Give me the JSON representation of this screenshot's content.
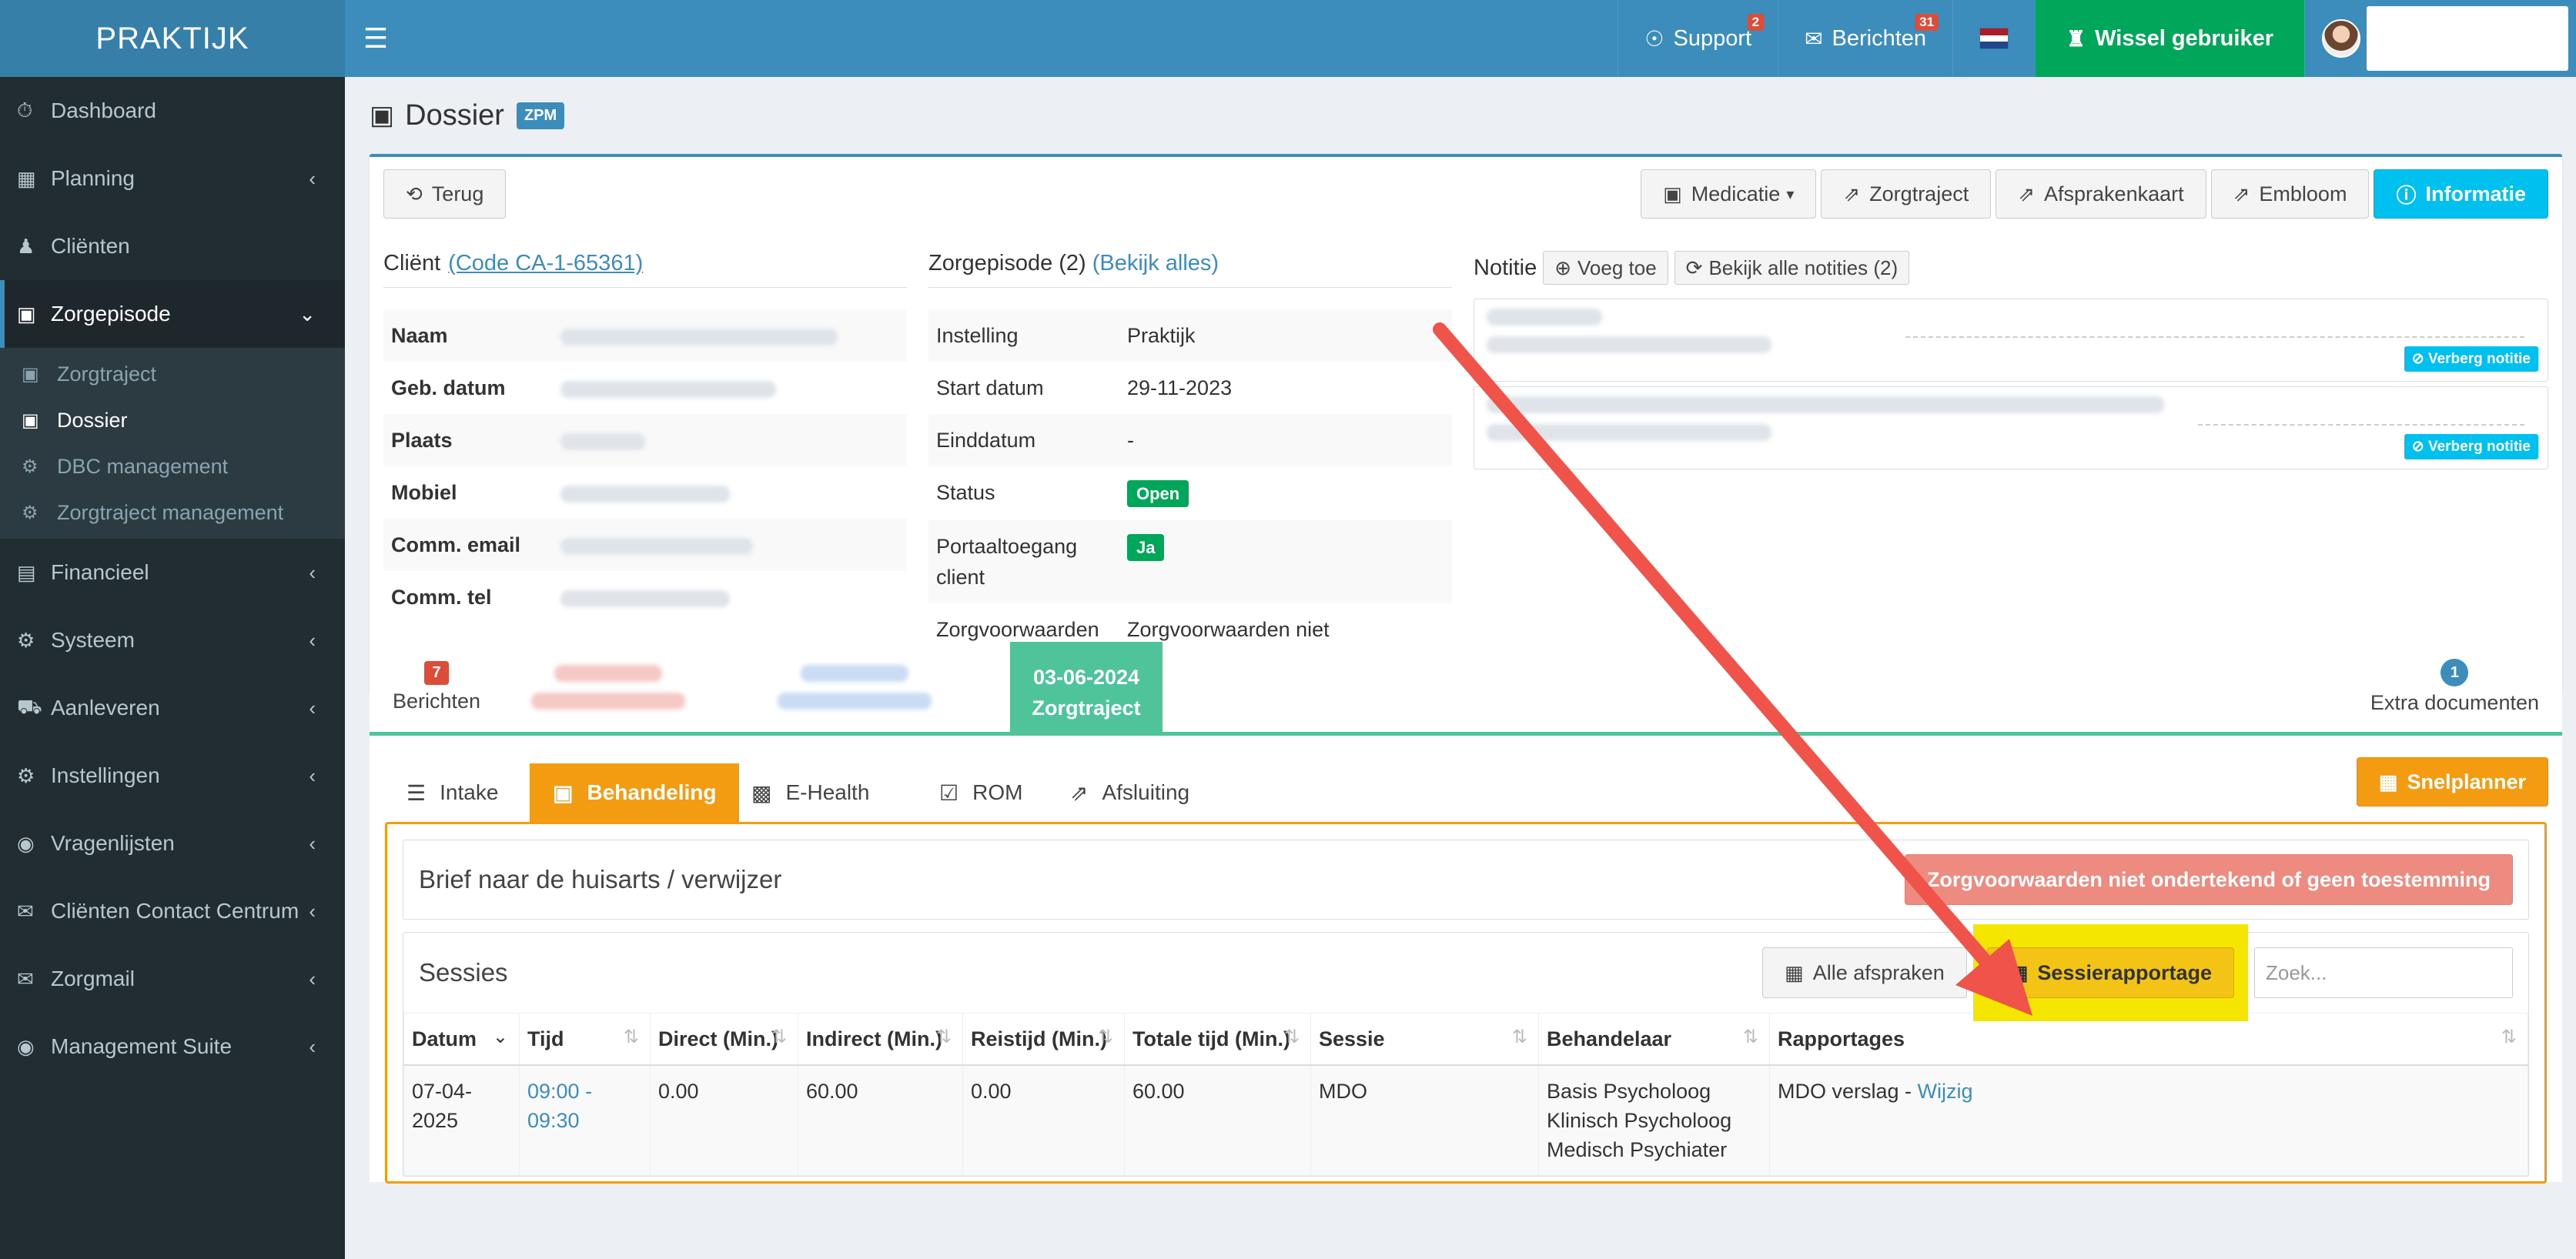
{
  "header": {
    "logo": "PRAKTIJK",
    "support_label": "Support",
    "support_badge": "2",
    "berichten_label": "Berichten",
    "berichten_badge": "31",
    "wissel_label": "Wissel gebruiker",
    "accent_color": "#3c8dbc",
    "success_color": "#00a65a"
  },
  "sidebar": {
    "items": [
      {
        "label": "Dashboard",
        "icon": "dashboard-icon"
      },
      {
        "label": "Planning",
        "icon": "calendar-icon"
      },
      {
        "label": "Cliënten",
        "icon": "user-icon"
      },
      {
        "label": "Zorgepisode",
        "icon": "medkit-icon"
      },
      {
        "label": "Financieel",
        "icon": "book-icon"
      },
      {
        "label": "Systeem",
        "icon": "cogs-icon"
      },
      {
        "label": "Aanleveren",
        "icon": "truck-icon"
      },
      {
        "label": "Instellingen",
        "icon": "gear-icon"
      },
      {
        "label": "Vragenlijsten",
        "icon": "globe-icon"
      },
      {
        "label": "Cliënten Contact Centrum",
        "icon": "envelope-icon"
      },
      {
        "label": "Zorgmail",
        "icon": "envelope-icon"
      },
      {
        "label": "Management Suite",
        "icon": "globe-icon"
      }
    ],
    "subitems": [
      {
        "label": "Zorgtraject"
      },
      {
        "label": "Dossier"
      },
      {
        "label": "DBC management"
      },
      {
        "label": "Zorgtraject management"
      }
    ]
  },
  "page": {
    "title": "Dossier",
    "badge": "ZPM"
  },
  "toolbar": {
    "back": "Terug",
    "medicatie": "Medicatie",
    "zorgtraject": "Zorgtraject",
    "afsprakenkaart": "Afsprakenkaart",
    "embloom": "Embloom",
    "informatie": "Informatie"
  },
  "client": {
    "heading": "Cliënt",
    "code_link": "(Code CA-1-65361)",
    "rows": [
      {
        "label": "Naam"
      },
      {
        "label": "Geb. datum"
      },
      {
        "label": "Plaats"
      },
      {
        "label": "Mobiel"
      },
      {
        "label": "Comm. email"
      },
      {
        "label": "Comm. tel"
      }
    ]
  },
  "zorgepisode": {
    "heading": "Zorgepisode (2)",
    "link": "(Bekijk alles)",
    "rows": [
      {
        "label": "Instelling",
        "value": "Praktijk"
      },
      {
        "label": "Start datum",
        "value": "29-11-2023"
      },
      {
        "label": "Einddatum",
        "value": "-"
      },
      {
        "label": "Status",
        "value": "Open"
      },
      {
        "label": "Portaaltoegang client",
        "value": "Ja"
      },
      {
        "label": "Zorgvoorwaarden",
        "value": "Zorgvoorwaarden niet ondertekend of geen toestemming"
      }
    ]
  },
  "notitie": {
    "heading": "Notitie",
    "add": "Voeg toe",
    "view_all": "Bekijk alle notities (2)",
    "hide_label": "Verberg notitie"
  },
  "timeline": {
    "berichten_badge": "7",
    "berichten": "Berichten",
    "active_date": "03-06-2024",
    "active_label": "Zorgtraject",
    "extra_badge": "1",
    "extra": "Extra documenten"
  },
  "tabs": [
    {
      "label": "Intake"
    },
    {
      "label": "Behandeling"
    },
    {
      "label": "E-Health"
    },
    {
      "label": "ROM"
    },
    {
      "label": "Afsluiting"
    }
  ],
  "snelplanner": "Snelplanner",
  "brief": {
    "title": "Brief naar de huisarts / verwijzer",
    "warning": "Zorgvoorwaarden niet ondertekend of geen toestemming"
  },
  "sessies": {
    "title": "Sessies",
    "alle_afspraken": "Alle afspraken",
    "sessierapportage": "Sessierapportage",
    "search_placeholder": "Zoek...",
    "columns": [
      "Datum",
      "Tijd",
      "Direct (Min.)",
      "Indirect (Min.)",
      "Reistijd (Min.)",
      "Totale tijd (Min.)",
      "Sessie",
      "Behandelaar",
      "Rapportages"
    ],
    "rows": [
      {
        "datum": "07-04-2025",
        "tijd": "09:00 - 09:30",
        "direct": "0.00",
        "indirect": "60.00",
        "reistijd": "0.00",
        "totaal": "60.00",
        "sessie": "MDO",
        "behandelaar_1": "Basis Psycholoog",
        "behandelaar_2": "Klinisch Psycholoog",
        "behandelaar_3": "Medisch Psychiater",
        "rapportage": "MDO verslag - ",
        "wijzig": "Wijzig"
      }
    ]
  }
}
